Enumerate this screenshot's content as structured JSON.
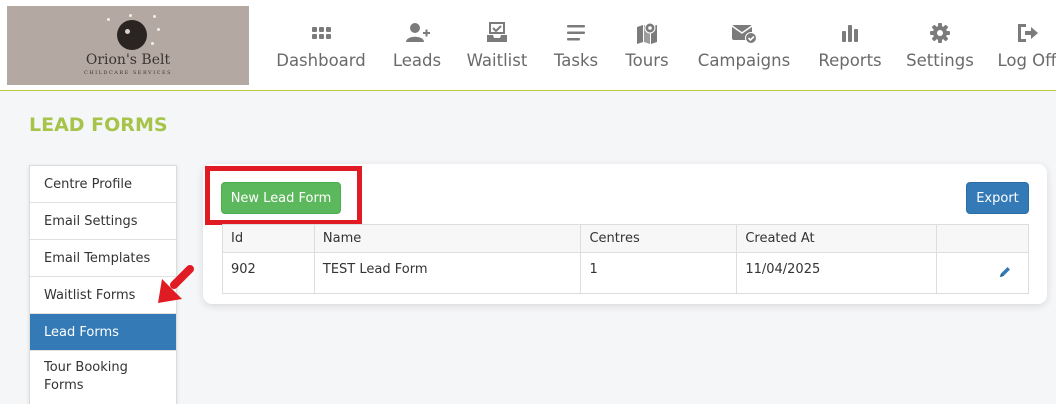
{
  "brand": {
    "name": "Orion's Belt",
    "tagline": "CHILDCARE SERVICES"
  },
  "nav": [
    {
      "label": "Dashboard",
      "icon": "dashboard-icon"
    },
    {
      "label": "Leads",
      "icon": "add-user-icon"
    },
    {
      "label": "Waitlist",
      "icon": "inbox-check-icon"
    },
    {
      "label": "Tasks",
      "icon": "list-icon"
    },
    {
      "label": "Tours",
      "icon": "map-pin-icon"
    },
    {
      "label": "Campaigns",
      "icon": "envelope-check-icon"
    },
    {
      "label": "Reports",
      "icon": "bar-chart-icon"
    },
    {
      "label": "Settings",
      "icon": "gear-icon"
    },
    {
      "label": "Log Off",
      "icon": "logout-icon"
    }
  ],
  "page": {
    "title": "LEAD FORMS"
  },
  "sidebar": {
    "items": [
      {
        "label": "Centre Profile"
      },
      {
        "label": "Email Settings"
      },
      {
        "label": "Email Templates"
      },
      {
        "label": "Waitlist Forms"
      },
      {
        "label": "Lead Forms",
        "active": true
      },
      {
        "label": "Tour Booking Forms"
      }
    ]
  },
  "toolbar": {
    "new_label": "New Lead Form",
    "export_label": "Export"
  },
  "table": {
    "columns": [
      "Id",
      "Name",
      "Centres",
      "Created At",
      ""
    ],
    "rows": [
      {
        "id": "902",
        "name": "TEST Lead Form",
        "centres": "1",
        "created_at": "11/04/2025"
      }
    ]
  },
  "colors": {
    "accent_green": "#a6c34a",
    "primary_blue": "#337ab7",
    "success_green": "#5cb85c",
    "highlight_red": "#e01b24"
  }
}
